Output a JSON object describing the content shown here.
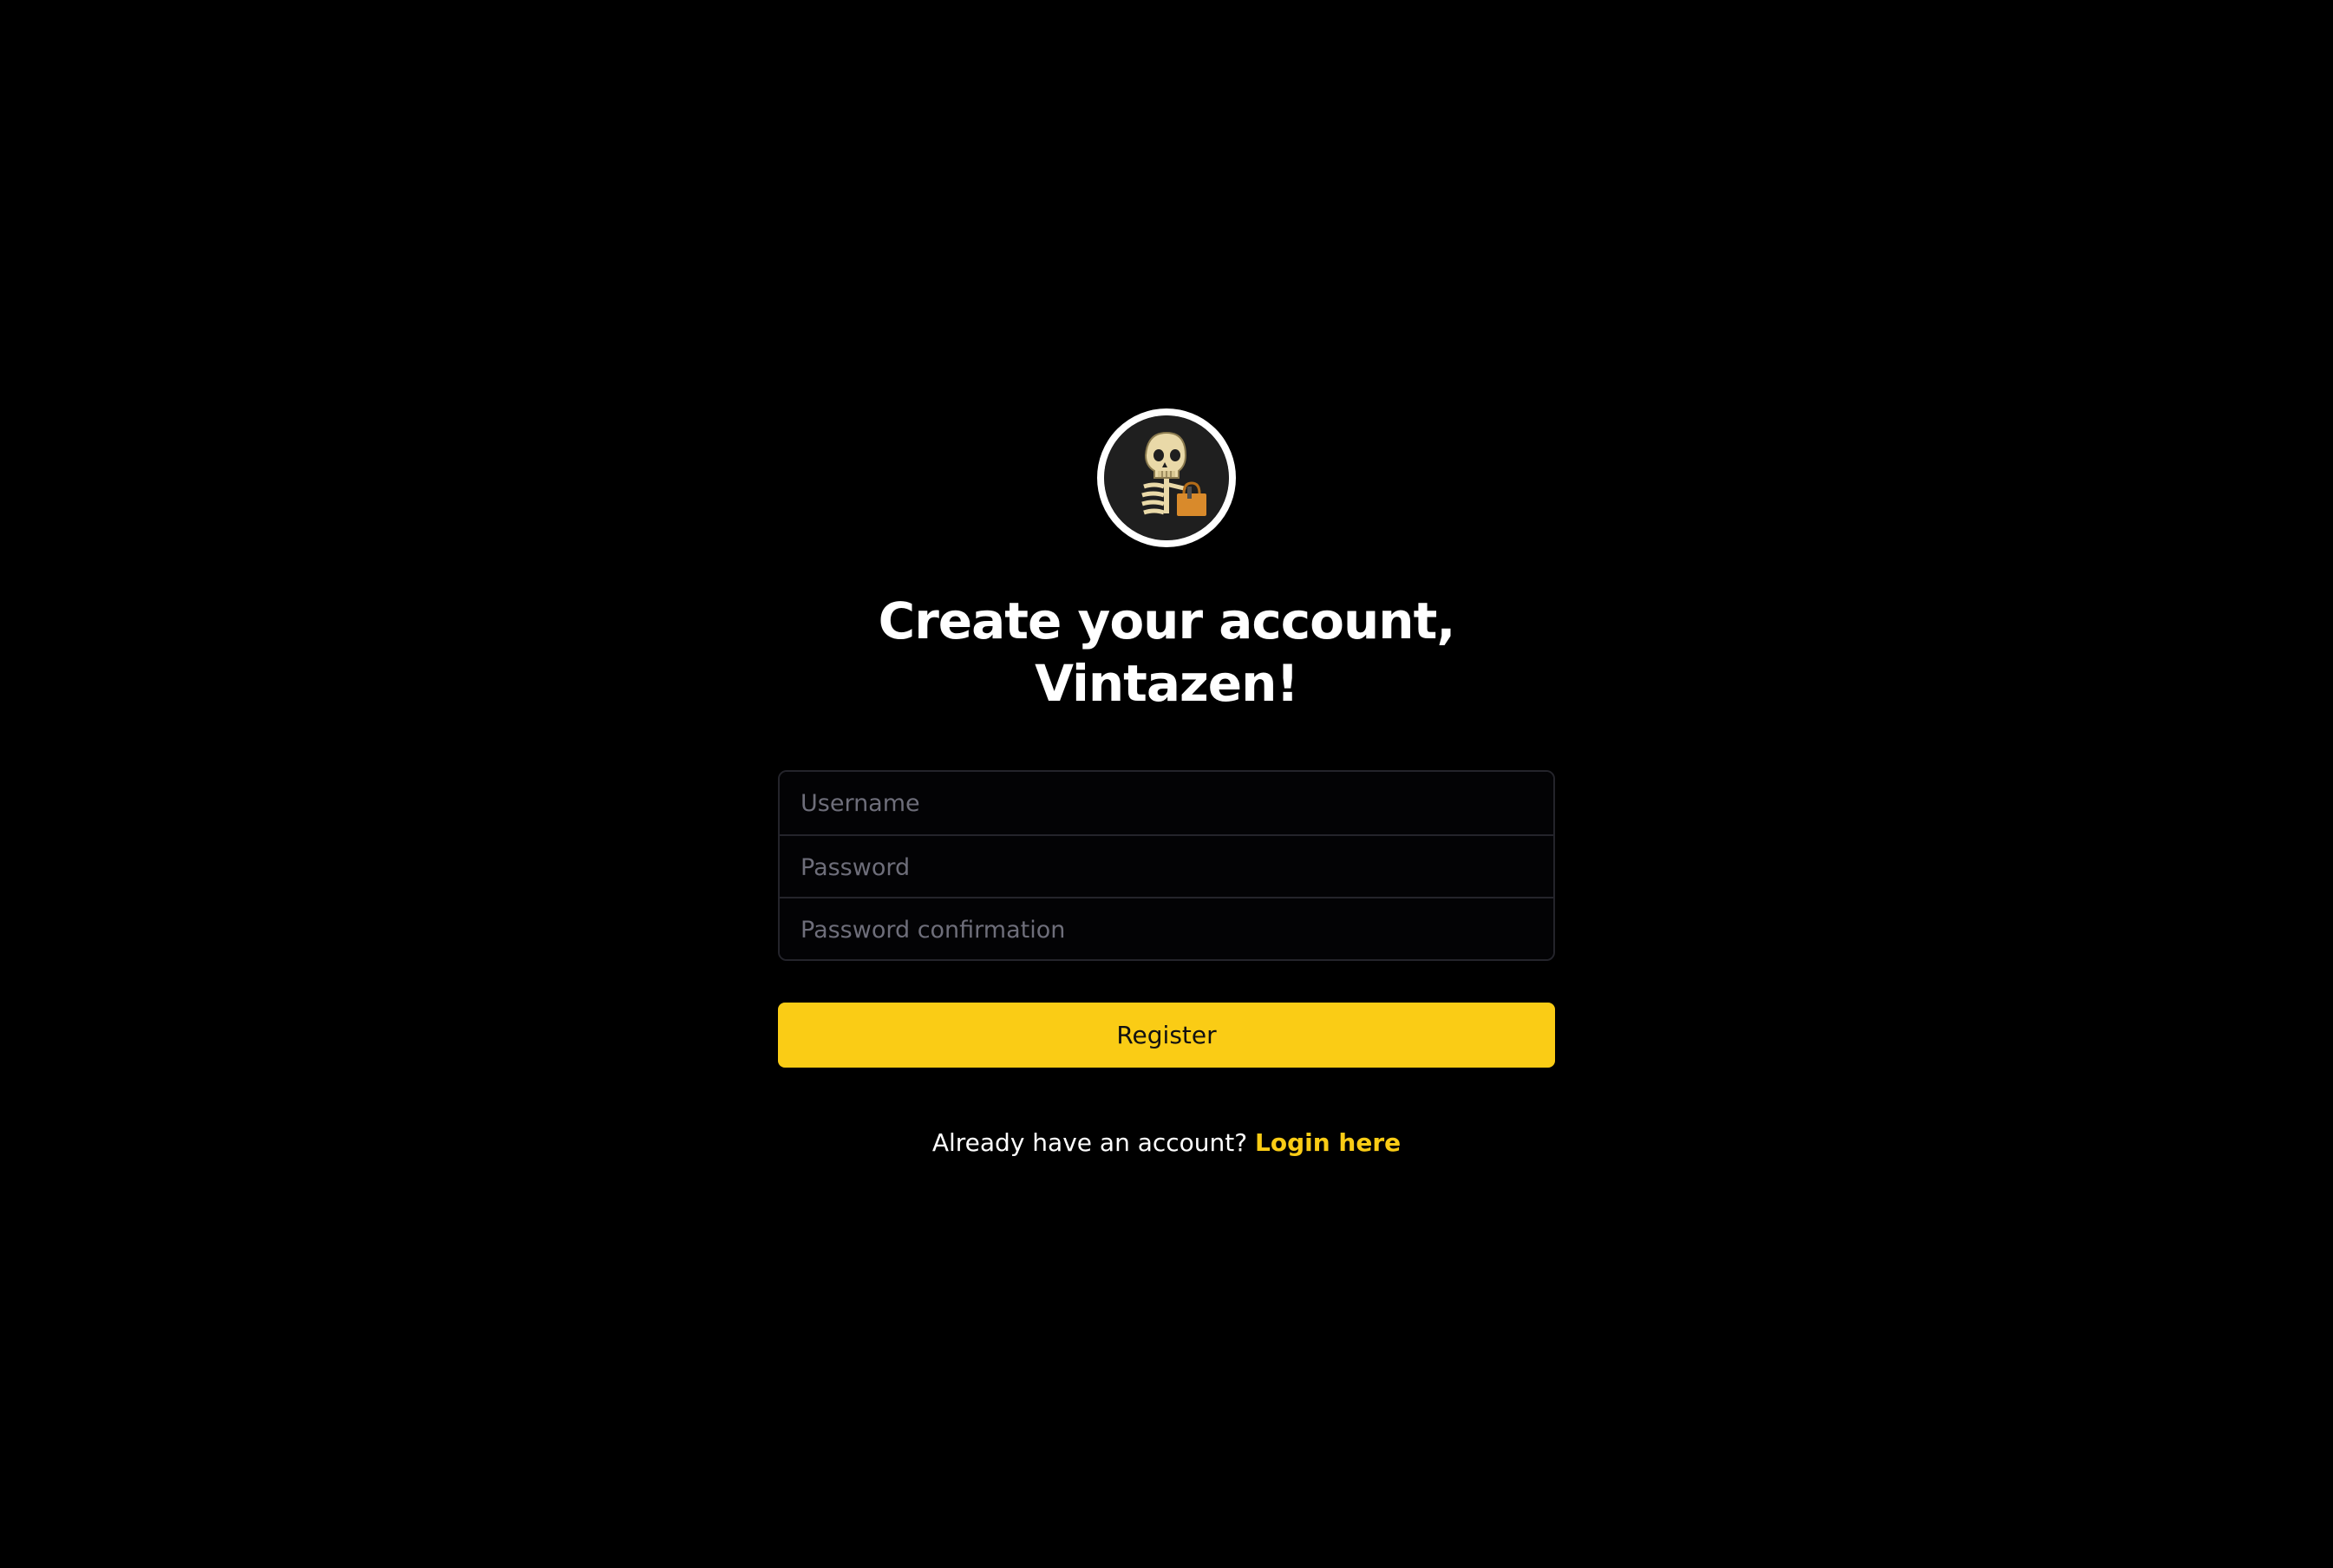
{
  "header": {
    "title_line1": "Create your account,",
    "title_line2": "Vintazen!"
  },
  "avatar": {
    "icon": "skeleton-with-shopping-bag-icon"
  },
  "form": {
    "username_placeholder": "Username",
    "password_placeholder": "Password",
    "password_confirmation_placeholder": "Password confirmation",
    "username_value": "",
    "password_value": "",
    "password_confirmation_value": ""
  },
  "actions": {
    "register_label": "Register"
  },
  "footer": {
    "prompt": "Already have an account?",
    "login_link": "Login here"
  },
  "colors": {
    "background": "#000000",
    "accent": "#facc15",
    "text": "#ffffff",
    "placeholder": "#6e6e7a",
    "border": "#24242b"
  }
}
